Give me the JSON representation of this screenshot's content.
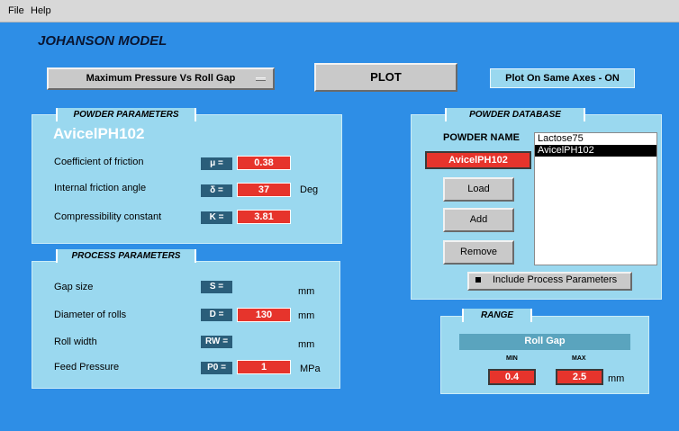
{
  "menu": {
    "file": "File",
    "help": "Help"
  },
  "app_title": "JOHANSON MODEL",
  "toolbar": {
    "plot_type_selected": "Maximum Pressure Vs Roll Gap",
    "plot_label": "PLOT",
    "same_axes_label": "Plot On Same Axes - ON"
  },
  "powder_params": {
    "title": "POWDER PARAMETERS",
    "powder_name": "AvicelPH102",
    "rows": [
      {
        "label": "Coefficient of friction",
        "symbol": "μ =",
        "value": "0.38",
        "unit": ""
      },
      {
        "label": "Internal friction angle",
        "symbol": "δ =",
        "value": "37",
        "unit": "Deg"
      },
      {
        "label": "Compressibility constant",
        "symbol": "K =",
        "value": "3.81",
        "unit": ""
      }
    ]
  },
  "process_params": {
    "title": "PROCESS PARAMETERS",
    "rows": [
      {
        "label": "Gap size",
        "symbol": "S =",
        "value": "",
        "unit": "mm"
      },
      {
        "label": "Diameter of rolls",
        "symbol": "D =",
        "value": "130",
        "unit": "mm"
      },
      {
        "label": "Roll width",
        "symbol": "RW =",
        "value": "",
        "unit": "mm"
      },
      {
        "label": "Feed Pressure",
        "symbol": "P0 =",
        "value": "1",
        "unit": "MPa"
      }
    ]
  },
  "powder_database": {
    "title": "POWDER DATABASE",
    "powder_name_label": "POWDER NAME",
    "current_powder": "AvicelPH102",
    "list": [
      "Lactose75",
      "AvicelPH102"
    ],
    "selected_index": 1,
    "load_label": "Load",
    "add_label": "Add",
    "remove_label": "Remove",
    "include_label": "Include Process Parameters"
  },
  "range": {
    "title": "RANGE",
    "variable": "Roll Gap",
    "min_label": "MIN",
    "max_label": "MAX",
    "min_value": "0.4",
    "max_value": "2.5",
    "unit": "mm"
  },
  "colors": {
    "background": "#2e8ee6",
    "panel": "#9ad8ef",
    "value_field": "#e6342c",
    "symbol_tag": "#2a5e7a"
  }
}
